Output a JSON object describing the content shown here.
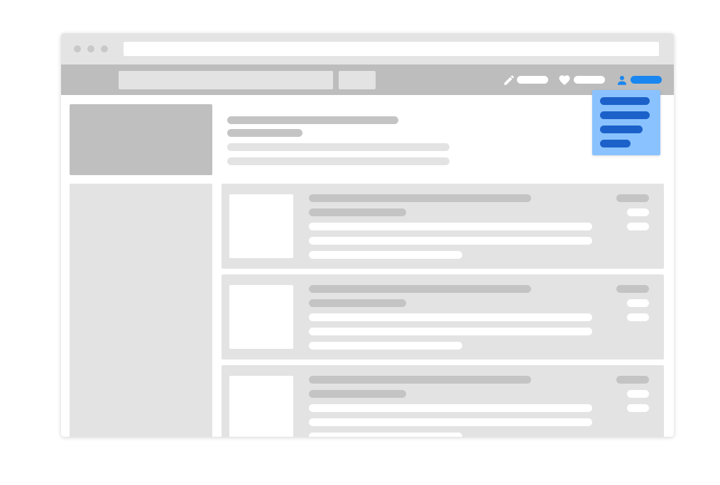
{
  "window": {
    "title": "",
    "address": ""
  },
  "header": {
    "search_placeholder": "",
    "search_button_label": "",
    "nav": {
      "edit_label": "",
      "favorites_label": "",
      "account_label": ""
    }
  },
  "account_menu": {
    "items": [
      "",
      "",
      "",
      ""
    ]
  },
  "profile": {
    "name": "",
    "subtitle": "",
    "description_lines": [
      "",
      ""
    ]
  },
  "listings": [
    {
      "title": "",
      "subtitle": "",
      "lines": [
        "",
        "",
        ""
      ],
      "meta": [
        "",
        "",
        ""
      ]
    },
    {
      "title": "",
      "subtitle": "",
      "lines": [
        "",
        "",
        ""
      ],
      "meta": [
        "",
        "",
        ""
      ]
    },
    {
      "title": "",
      "subtitle": "",
      "lines": [
        "",
        "",
        ""
      ],
      "meta": [
        "",
        "",
        ""
      ]
    }
  ],
  "colors": {
    "accent": "#1a86ef",
    "dropdown_background": "#8ac2ff",
    "dropdown_item": "#1c61c9",
    "header_background": "#bdbdbd",
    "placeholder_light": "#e3e3e3",
    "placeholder_dark": "#c4c4c4"
  },
  "icons": {
    "edit": "pencil-icon",
    "favorites": "heart-icon",
    "account": "user-icon"
  }
}
